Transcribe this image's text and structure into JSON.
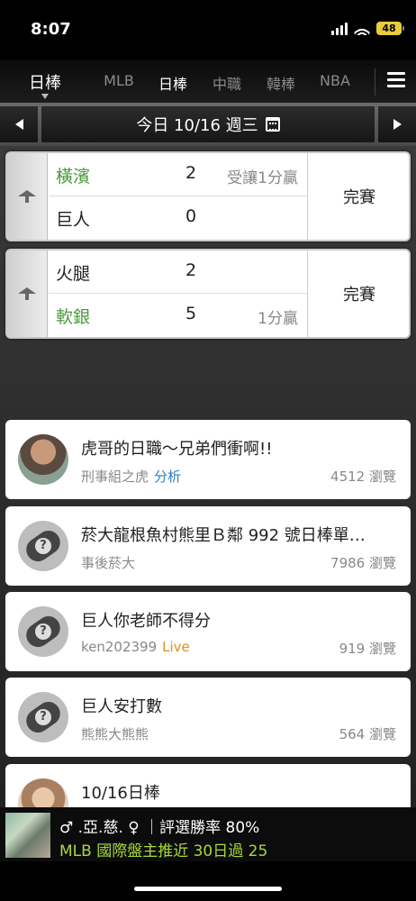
{
  "status": {
    "time": "8:07",
    "battery": "48"
  },
  "nav": {
    "current": "日棒",
    "tabs": [
      "MLB",
      "日棒",
      "中職",
      "韓棒",
      "NBA"
    ],
    "active_index": 1
  },
  "date": {
    "label": "今日 10/16 週三"
  },
  "games": [
    {
      "team1": {
        "name": "橫濱",
        "score": "2",
        "note": "受讓1分贏",
        "highlight": true
      },
      "team2": {
        "name": "巨人",
        "score": "0",
        "note": "",
        "highlight": false
      },
      "status": "完賽"
    },
    {
      "team1": {
        "name": "火腿",
        "score": "2",
        "note": "",
        "highlight": false
      },
      "team2": {
        "name": "軟銀",
        "score": "5",
        "note": "1分贏",
        "highlight": true
      },
      "status": "完賽"
    }
  ],
  "posts": [
    {
      "title": "虎哥的日職～兄弟們衝啊!!",
      "author": "刑事組之虎",
      "tag": "分析",
      "views": "4512 瀏覽"
    },
    {
      "title": "菸大龍根魚村熊里Ｂ鄰 992 號日棒單…",
      "author": "事後菸大",
      "tag": "",
      "views": "7986 瀏覽"
    },
    {
      "title": "巨人你老師不得分",
      "author": "ken202399",
      "tag": "Live",
      "views": "919 瀏覽"
    },
    {
      "title": "巨人安打數",
      "author": "熊熊大熊熊",
      "tag": "",
      "views": "564 瀏覽"
    },
    {
      "title": "10/16日棒",
      "author": "",
      "tag": "",
      "views": ""
    }
  ],
  "promo": {
    "line1": "♂ .亞.慈. ♀ ｜評選勝率 80%",
    "line2": "MLB 國際盤主推近 30日過 25"
  },
  "colors": {
    "win_green": "#4a9a3c",
    "tag_blue": "#2d7ec8",
    "tag_orange": "#e88a1e",
    "promo_green": "#a8d83a"
  }
}
